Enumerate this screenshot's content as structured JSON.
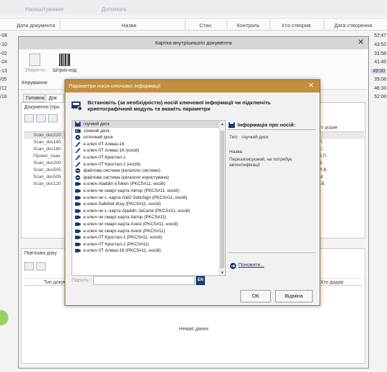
{
  "background": {
    "menu": [
      "Налаштування",
      "Допомога"
    ],
    "columns": [
      "Дата документа",
      "Назва",
      "Стан",
      "Контроль",
      "Хто створив",
      "Дата створення"
    ],
    "times": [
      "52:47",
      "43:52",
      "31:58",
      "41:45",
      "49:00",
      "39:08",
      "46:33",
      "52:08"
    ],
    "left_nums": [
      "-08",
      "-10",
      "-02",
      "-24",
      "-13",
      "/05",
      "/12",
      "/18"
    ]
  },
  "card": {
    "title": "Картка внутрішнього документа",
    "ribbon": {
      "save_label": "Зберегти",
      "barcode_label": "Штрих-код",
      "group_label": "Керування"
    },
    "tabs": [
      "Головна",
      "Док"
    ],
    "docs_caption": "Документи (про",
    "docs_col_header": "Н",
    "docs": [
      "Scan_doc220",
      "Scan_doc140",
      "Scan_doc180",
      "Проект_скан",
      "Scan_doc200",
      "Scan_doc505",
      "Scan_doc505",
      "Scan_doc120"
    ],
    "added_by_header": "то додав",
    "added_by": [
      "П.",
      "С.",
      "З.П.",
      "В.",
      "И.В.",
      "М.",
      "І.В."
    ],
    "related_caption": "Пов'язані доку",
    "related_cols": [
      "Тип докуме",
      "Хто додав"
    ],
    "empty_text": "Немає даних"
  },
  "dialog": {
    "title": "Параметри носія ключової інформації",
    "header_text": "Встановіть (за необхідністю) носій ключової інформації чи підключіть криптографічний модуль та вкажіть параметри",
    "media": [
      {
        "label": "гнучкий диск",
        "icon": "floppy-icon"
      },
      {
        "label": "з'ємний диск",
        "icon": "removable-disk-icon"
      },
      {
        "label": "оптичний диск",
        "icon": "optical-disk-icon"
      },
      {
        "label": "е.ключ ІІТ Алмаз-1К",
        "icon": "usb-key-icon"
      },
      {
        "label": "е.ключ ІІТ Алмаз-1К (носій)",
        "icon": "usb-key-icon"
      },
      {
        "label": "е.ключ ІІТ Кристал-1",
        "icon": "usb-key-icon"
      },
      {
        "label": "е.ключ ІІТ Кристал-1 (носій)",
        "icon": "usb-key-icon"
      },
      {
        "label": "файлова система (каталоги системи)",
        "icon": "filesystem-icon"
      },
      {
        "label": "файлова система (каталоги користувача)",
        "icon": "filesystem-icon"
      },
      {
        "label": "е.ключ Aladdin eToken (PKCS#11, носій)",
        "icon": "token-icon"
      },
      {
        "label": "е.ключ чи смарт-карта Автор (PKCS#11, носій)",
        "icon": "token-icon"
      },
      {
        "label": "е.ключ чи с.-карта G&D SafeSign (PKCS#11, носій)",
        "icon": "token-icon"
      },
      {
        "label": "е.ключ SafeNet iKey (PKCS#11, носій)",
        "icon": "token-icon"
      },
      {
        "label": "е.ключ чи с.-карта Aladdin JaCarta (PKCS#11, носій)",
        "icon": "token-icon"
      },
      {
        "label": "е.ключ чи смарт-карта Автор (PKCS#11)",
        "icon": "token-icon"
      },
      {
        "label": "е.ключ чи смарт-карта Avest (PKCS#11, носій)",
        "icon": "token-icon"
      },
      {
        "label": "е.ключ чи смарт-карта Avest (PKCS#11)",
        "icon": "token-icon"
      },
      {
        "label": "е.ключ ІІТ Кристал-1 (PKCS#11, носій)",
        "icon": "token-icon"
      },
      {
        "label": "е.ключ ІІТ Кристал-1 (PKCS#11)",
        "icon": "token-icon"
      },
      {
        "label": "е.ключ ІІТ Алмаз-1К (PKCS#11, носій)",
        "icon": "token-icon"
      }
    ],
    "info_title": "Інформація про носій:",
    "info_type_label": "Тип:",
    "info_type_value": "гнучкий диск",
    "info_name_label": "Назва:",
    "info_name_value": "",
    "info_note": "Перезаписуємий, не потребує автентифікації",
    "refresh_label": "Поновити...",
    "password_label": "Пароль:",
    "password_value": "",
    "lang": "EN",
    "ok_label": "OK",
    "cancel_label": "Відміна",
    "accent": "#c28f3c"
  }
}
